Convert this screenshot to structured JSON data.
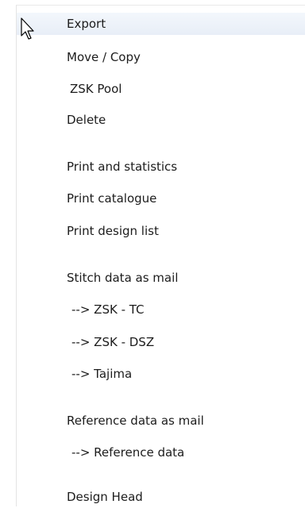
{
  "context_menu": {
    "items": [
      {
        "label": "Export"
      },
      {
        "label": "Move / Copy"
      },
      {
        "label": "ZSK Pool"
      },
      {
        "label": "Delete"
      },
      {
        "label": "Print and statistics"
      },
      {
        "label": "Print catalogue"
      },
      {
        "label": "Print design list"
      },
      {
        "label": "Stitch data as mail"
      },
      {
        "label": "-->  ZSK - TC"
      },
      {
        "label": "-->  ZSK - DSZ"
      },
      {
        "label": "-->  Tajima"
      },
      {
        "label": "Reference data as mail"
      },
      {
        "label": "-->  Reference data"
      },
      {
        "label": "Design Head"
      }
    ],
    "highlighted_index": 0
  },
  "cursor": {
    "icon": "arrow-cursor-icon"
  }
}
